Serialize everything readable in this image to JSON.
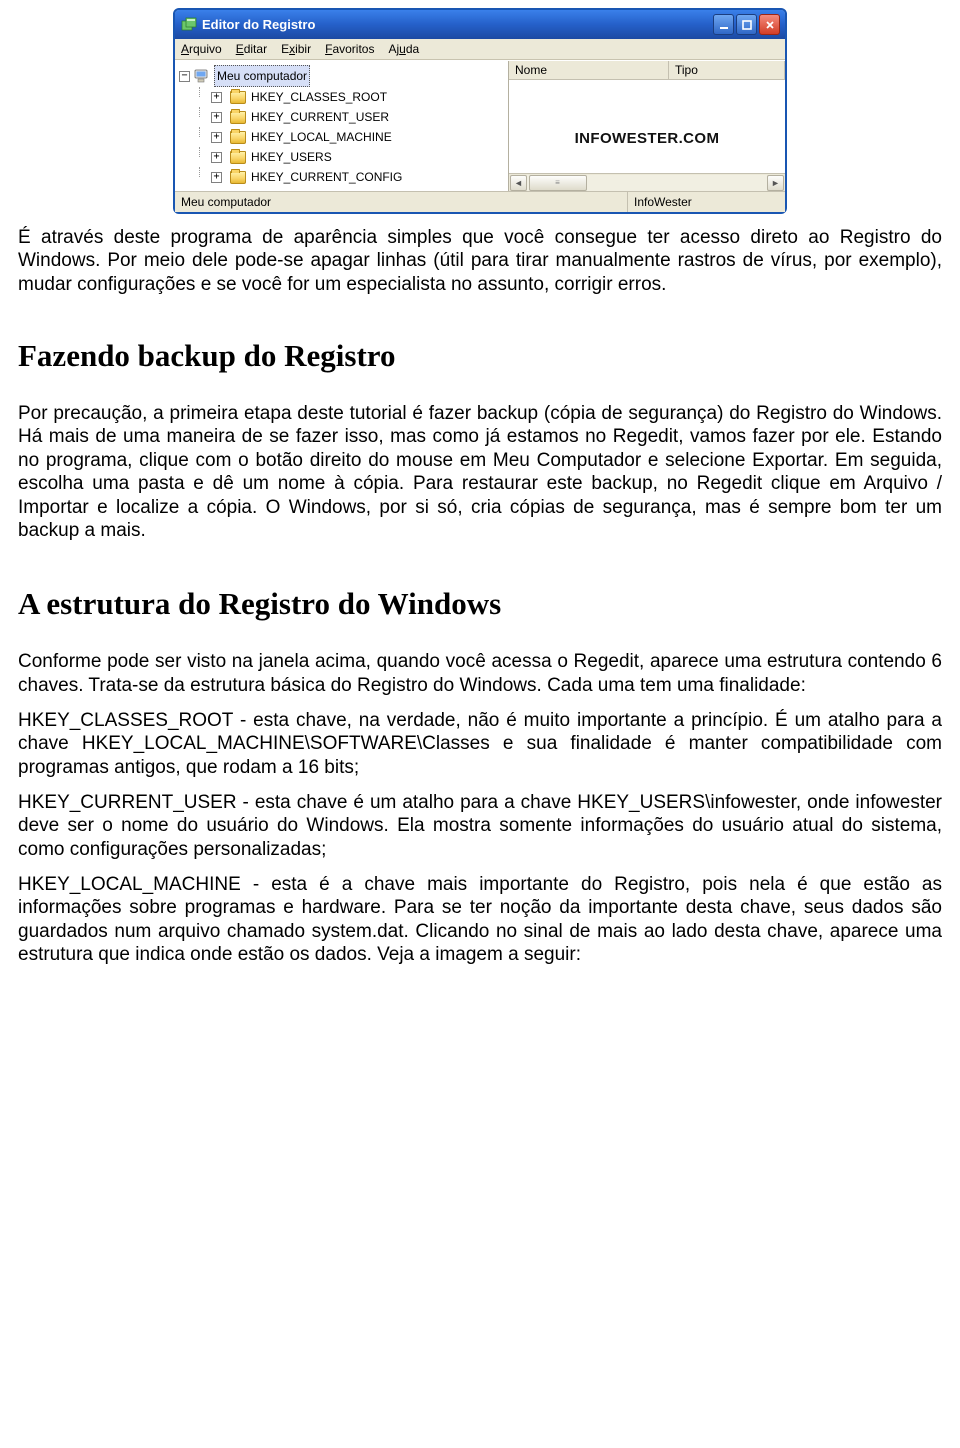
{
  "window": {
    "title": "Editor do Registro",
    "menu": {
      "arquivo": "Arquivo",
      "editar": "Editar",
      "exibir": "Exibir",
      "favoritos": "Favoritos",
      "ajuda": "Ajuda"
    },
    "tree_root": "Meu computador",
    "tree_children": [
      "HKEY_CLASSES_ROOT",
      "HKEY_CURRENT_USER",
      "HKEY_LOCAL_MACHINE",
      "HKEY_USERS",
      "HKEY_CURRENT_CONFIG"
    ],
    "columns": {
      "nome": "Nome",
      "tipo": "Tipo"
    },
    "watermark": "INFOWESTER.COM",
    "status_left": "Meu computador",
    "status_right": "InfoWester"
  },
  "doc": {
    "p1": "É através deste programa de aparência simples que você consegue ter acesso direto ao Registro do Windows. Por meio dele pode-se apagar linhas (útil para tirar manualmente rastros de vírus, por exemplo), mudar configurações e se você for um especialista no assunto, corrigir erros.",
    "h1": "Fazendo backup do Registro",
    "p2": "Por precaução, a primeira etapa deste tutorial é fazer backup (cópia de segurança) do Registro do Windows. Há mais de uma maneira de se fazer isso, mas como já estamos no Regedit, vamos fazer por ele. Estando no programa, clique com o botão direito do mouse em Meu Computador e selecione Exportar. Em seguida, escolha uma pasta e dê um nome à cópia. Para restaurar este backup, no Regedit clique em Arquivo / Importar e localize a cópia. O Windows, por si só, cria cópias de segurança, mas é sempre bom ter um backup a mais.",
    "h2": "A estrutura do Registro do Windows",
    "p3": "Conforme pode ser visto na janela acima, quando você acessa o Regedit, aparece uma estrutura contendo 6 chaves. Trata-se da estrutura básica do Registro do Windows. Cada uma tem uma finalidade:",
    "p4": "HKEY_CLASSES_ROOT - esta chave, na verdade, não é muito importante a princípio. É um atalho para a chave HKEY_LOCAL_MACHINE\\SOFTWARE\\Classes e sua finalidade é manter compatibilidade com programas antigos, que rodam a 16 bits;",
    "p5": "HKEY_CURRENT_USER - esta chave é um atalho para a chave HKEY_USERS\\infowester, onde infowester deve ser o nome do usuário do Windows. Ela mostra somente informações do usuário atual do sistema, como configurações personalizadas;",
    "p6": "HKEY_LOCAL_MACHINE - esta é a chave mais importante do Registro, pois nela é que estão as informações sobre programas e hardware. Para se ter noção da importante desta chave, seus dados são guardados num arquivo chamado system.dat. Clicando no sinal de mais ao lado desta chave, aparece uma estrutura que indica onde estão os dados. Veja a imagem a seguir:"
  }
}
